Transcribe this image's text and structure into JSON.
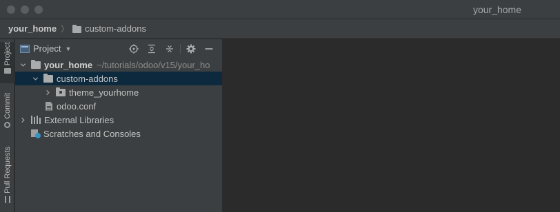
{
  "window": {
    "title": "your_home"
  },
  "navbar": {
    "root": "your_home",
    "folder": "custom-addons"
  },
  "tool_stripe": {
    "tabs": [
      {
        "label": "Project",
        "icon": "folder-icon"
      },
      {
        "label": "Commit",
        "icon": "commit-icon"
      },
      {
        "label": "Pull Requests",
        "icon": "pull-request-icon"
      }
    ]
  },
  "project_panel": {
    "title": "Project",
    "tools": [
      "locate-icon",
      "expand-all-icon",
      "collapse-all-icon",
      "gear-icon",
      "hide-icon"
    ],
    "tree": {
      "root": {
        "label": "your_home",
        "path": "~/tutorials/odoo/v15/your_ho"
      },
      "custom_addons": "custom-addons",
      "theme": "theme_yourhome",
      "conf": "odoo.conf",
      "external": "External Libraries",
      "scratches": "Scratches and Consoles"
    }
  }
}
